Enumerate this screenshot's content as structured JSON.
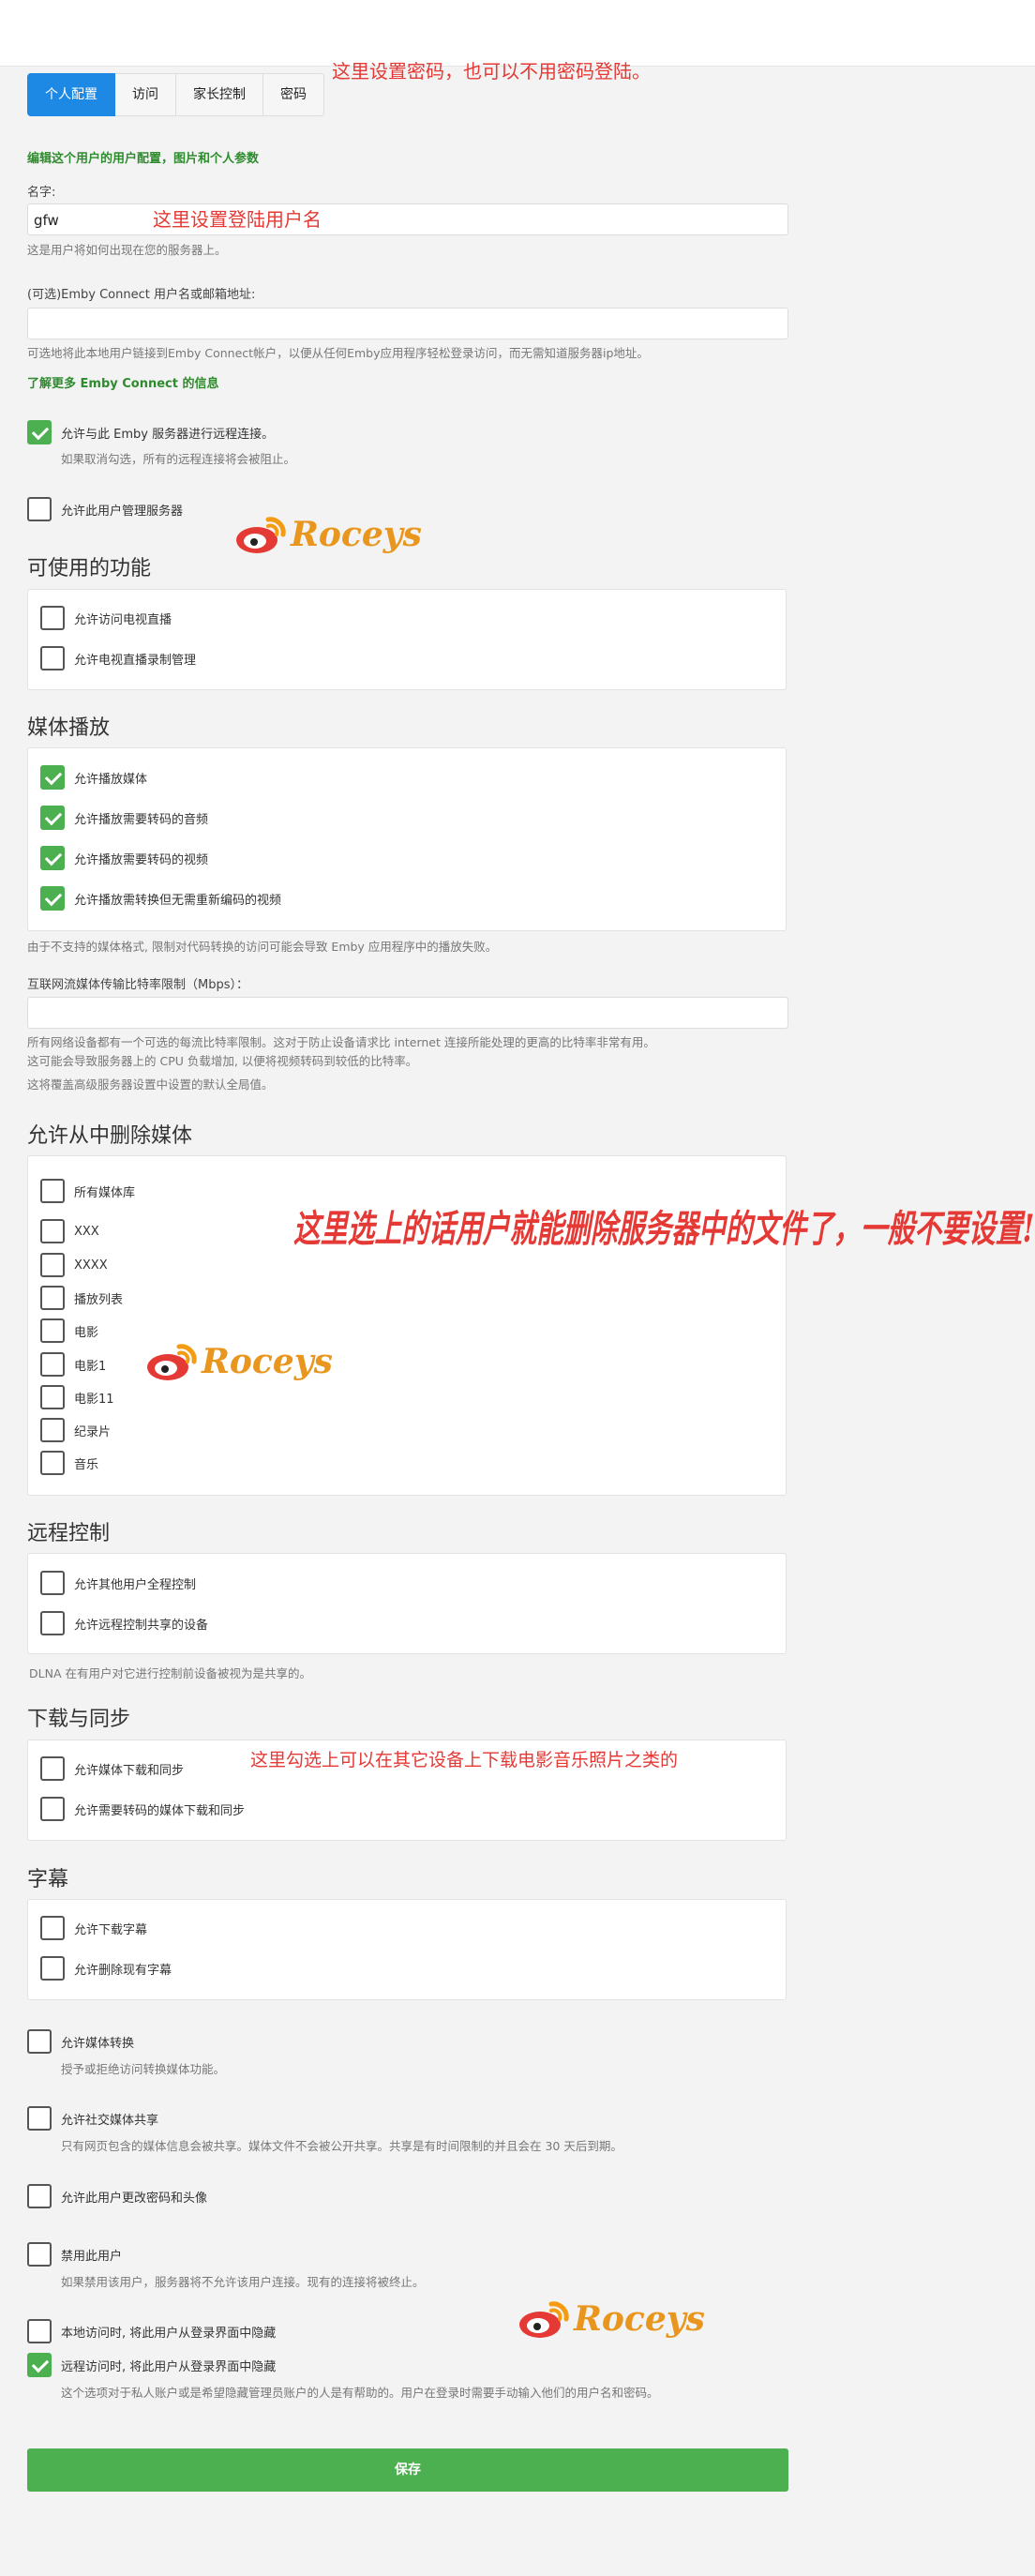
{
  "tabs": [
    "个人配置",
    "访问",
    "家长控制",
    "密码"
  ],
  "annotations": {
    "password": "这里设置密码，也可以不用密码登陆。",
    "username": "这里设置登陆用户名",
    "delete": "这里选上的话用户就能删除服务器中的文件了，一般不要设置!",
    "download": "这里勾选上可以在其它设备上下载电影音乐照片之类的"
  },
  "watermark": "Roceys",
  "profile": {
    "header": "编辑这个用户的用户配置，图片和个人参数",
    "name_label": "名字:",
    "name_value": "gfw",
    "name_help": "这是用户将如何出现在您的服务器上。",
    "connect_label": "(可选)Emby Connect 用户名或邮箱地址:",
    "connect_value": "",
    "connect_help": "可选地将此本地用户链接到Emby Connect帐户，以便从任何Emby应用程序轻松登录访问，而无需知道服务器ip地址。",
    "connect_link": "了解更多 Emby Connect 的信息",
    "remote_label": "允许与此 Emby 服务器进行远程连接。",
    "remote_help": "如果取消勾选，所有的远程连接将会被阻止。",
    "admin_label": "允许此用户管理服务器"
  },
  "features": {
    "title": "可使用的功能",
    "items": [
      {
        "label": "允许访问电视直播",
        "checked": false
      },
      {
        "label": "允许电视直播录制管理",
        "checked": false
      }
    ]
  },
  "playback": {
    "title": "媒体播放",
    "items": [
      {
        "label": "允许播放媒体",
        "checked": true
      },
      {
        "label": "允许播放需要转码的音频",
        "checked": true
      },
      {
        "label": "允许播放需要转码的视频",
        "checked": true
      },
      {
        "label": "允许播放需转换但无需重新编码的视频",
        "checked": true
      }
    ],
    "help": "由于不支持的媒体格式, 限制对代码转换的访问可能会导致 Emby 应用程序中的播放失败。",
    "bitrate_label": "互联网流媒体传输比特率限制（Mbps）：",
    "bitrate_value": "",
    "bitrate_help1": "所有网络设备都有一个可选的每流比特率限制。这对于防止设备请求比 internet 连接所能处理的更高的比特率非常有用。",
    "bitrate_help2": "这可能会导致服务器上的 CPU 负载增加, 以便将视频转码到较低的比特率。",
    "bitrate_help3": "这将覆盖高级服务器设置中设置的默认全局值。"
  },
  "delete": {
    "title": "允许从中删除媒体",
    "items": [
      "所有媒体库",
      "XXX",
      "XXXX",
      "播放列表",
      "电影",
      "电影1",
      "电影11",
      "纪录片",
      "音乐"
    ]
  },
  "remote": {
    "title": "远程控制",
    "items": [
      {
        "label": "允许其他用户全程控制",
        "checked": false
      },
      {
        "label": "允许远程控制共享的设备",
        "checked": false
      }
    ],
    "help": "DLNA 在有用户对它进行控制前设备被视为是共享的。"
  },
  "download": {
    "title": "下载与同步",
    "items": [
      {
        "label": "允许媒体下载和同步",
        "checked": false
      },
      {
        "label": "允许需要转码的媒体下载和同步",
        "checked": false
      }
    ]
  },
  "subtitles": {
    "title": "字幕",
    "items": [
      {
        "label": "允许下载字幕",
        "checked": false
      },
      {
        "label": "允许删除现有字幕",
        "checked": false
      }
    ]
  },
  "options": {
    "conversion_label": "允许媒体转换",
    "conversion_help": "授予或拒绝访问转换媒体功能。",
    "social_label": "允许社交媒体共享",
    "social_help": "只有网页包含的媒体信息会被共享。媒体文件不会被公开共享。共享是有时间限制的并且会在 30 天后到期。",
    "password_label": "允许此用户更改密码和头像",
    "disable_label": "禁用此用户",
    "disable_help": "如果禁用该用户，服务器将不允许该用户连接。现有的连接将被终止。",
    "hide_local_label": "本地访问时, 将此用户从登录界面中隐藏",
    "hide_remote_label": "远程访问时, 将此用户从登录界面中隐藏",
    "hide_help": "这个选项对于私人账户或是希望隐藏管理员账户的人是有帮助的。用户在登录时需要手动输入他们的用户名和密码。"
  },
  "save_label": "保存"
}
